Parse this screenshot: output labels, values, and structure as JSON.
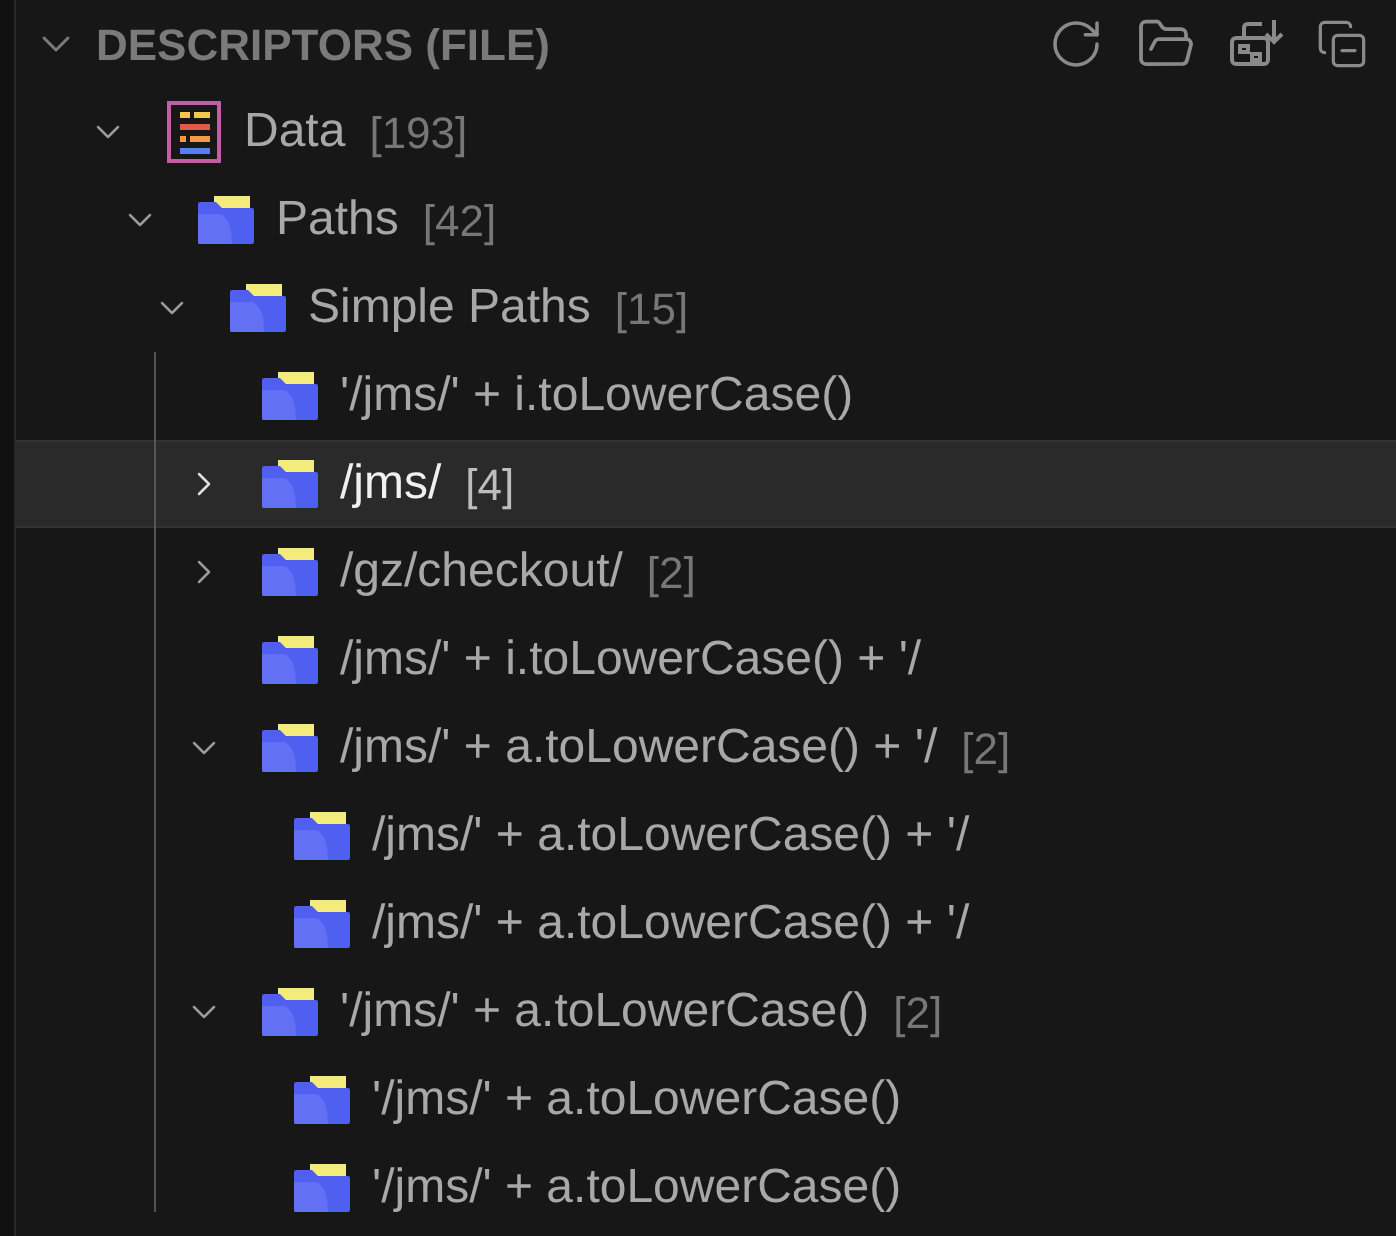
{
  "section": {
    "title": "DESCRIPTORS (FILE)",
    "expanded": true
  },
  "tree": [
    {
      "label": "Data",
      "count": "[193]",
      "expanded": true,
      "selected": false,
      "children": [
        {
          "label": "Paths",
          "count": "[42]",
          "expanded": true,
          "selected": false,
          "children": [
            {
              "label": "Simple Paths",
              "count": "[15]",
              "expanded": true,
              "selected": false,
              "children": [
                {
                  "label": "'/jms/' + i.toLowerCase()",
                  "selected": false
                },
                {
                  "label": "/jms/",
                  "count": "[4]",
                  "expanded": false,
                  "selected": true
                },
                {
                  "label": "/gz/checkout/",
                  "count": "[2]",
                  "expanded": false,
                  "selected": false
                },
                {
                  "label": "/jms/' + i.toLowerCase() + '/",
                  "selected": false
                },
                {
                  "label": "/jms/' + a.toLowerCase() + '/",
                  "count": "[2]",
                  "expanded": true,
                  "selected": false,
                  "children": [
                    {
                      "label": "/jms/' + a.toLowerCase() + '/",
                      "selected": false
                    },
                    {
                      "label": "/jms/' + a.toLowerCase() + '/",
                      "selected": false
                    }
                  ]
                },
                {
                  "label": "'/jms/' + a.toLowerCase()",
                  "count": "[2]",
                  "expanded": true,
                  "selected": false,
                  "children": [
                    {
                      "label": "'/jms/' + a.toLowerCase()",
                      "selected": false
                    },
                    {
                      "label": "'/jms/' + a.toLowerCase()",
                      "selected": false
                    }
                  ]
                }
              ]
            }
          ]
        }
      ]
    }
  ]
}
